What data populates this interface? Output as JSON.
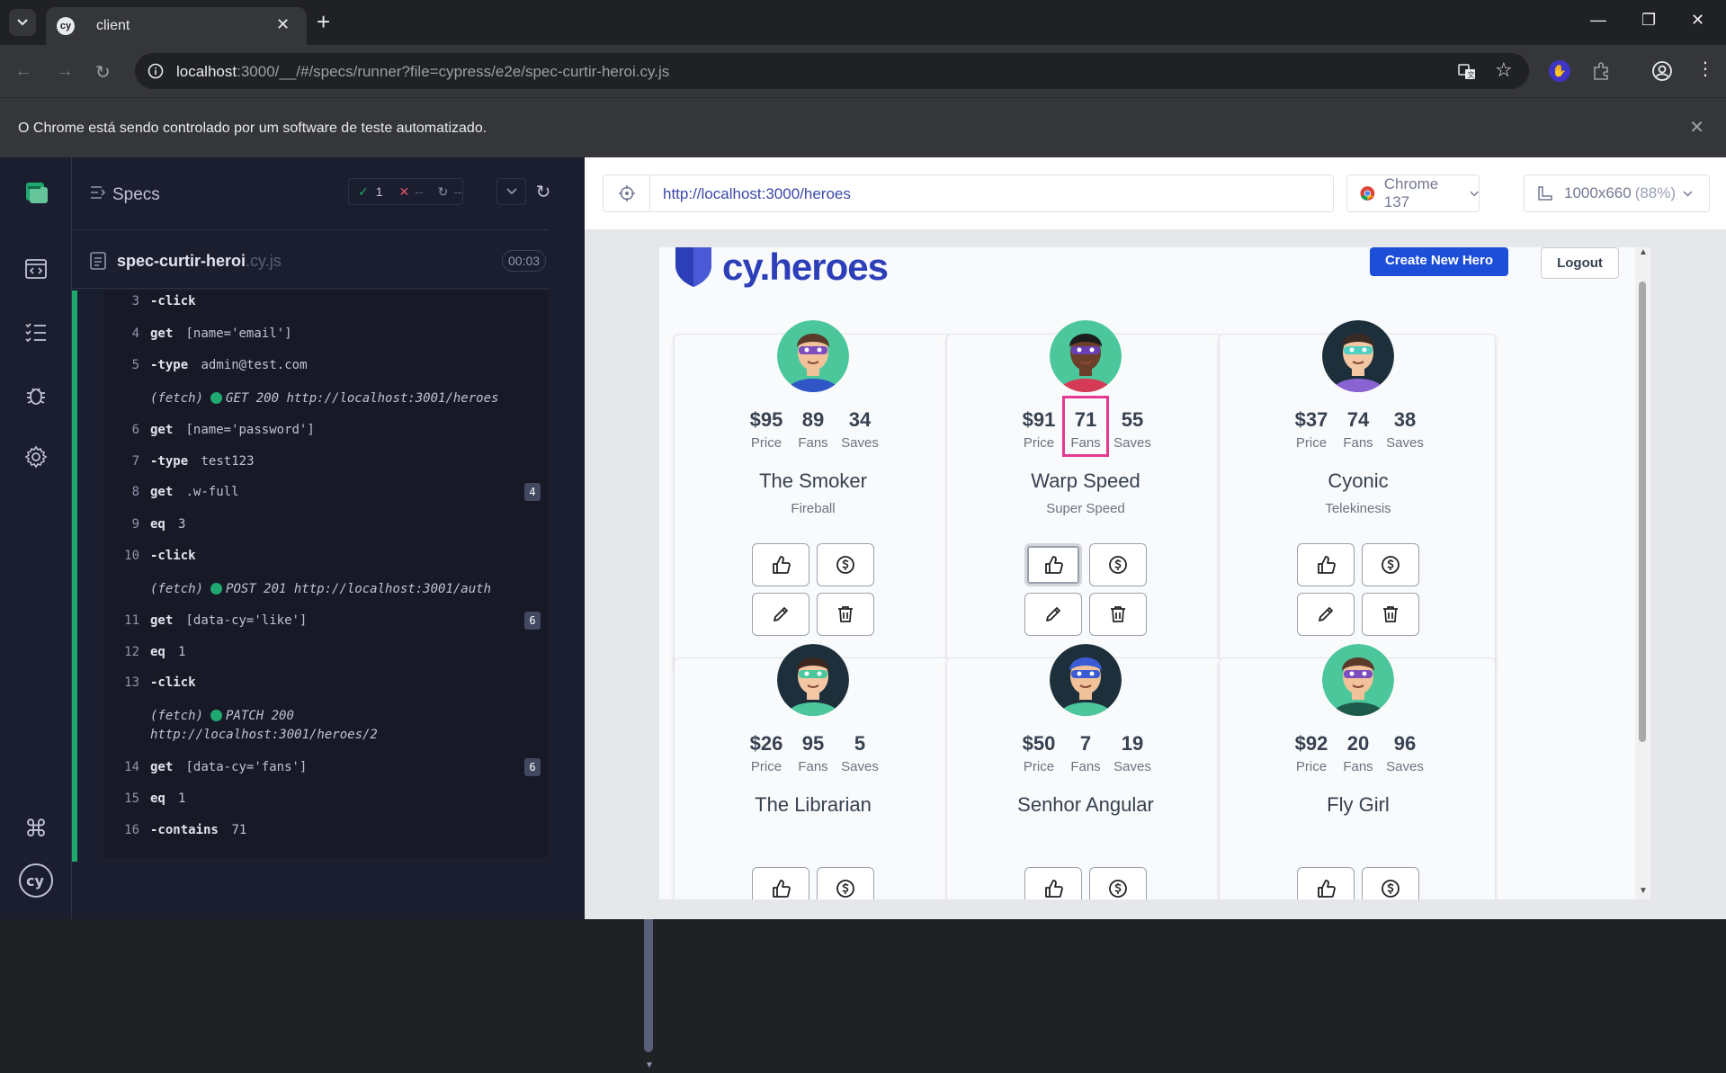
{
  "browser": {
    "tab_title": "client",
    "url_host": "localhost",
    "url_rest": ":3000/__/#/specs/runner?file=cypress/e2e/spec-curtir-heroi.cy.js",
    "infobar": "O Chrome está sendo controlado por um software de teste automatizado."
  },
  "reporter": {
    "specs_label": "Specs",
    "passed": "1",
    "failed": "--",
    "pending": "--",
    "file_name": "spec-curtir-heroi",
    "file_ext": ".cy.js",
    "duration": "00:03",
    "commands": [
      {
        "num": "3",
        "name": "-click",
        "arg": ""
      },
      {
        "num": "4",
        "name": "get",
        "arg": "[name='email']"
      },
      {
        "num": "5",
        "name": "-type",
        "arg": "admin@test.com"
      },
      {
        "fetch": "GET 200 http://localhost:3001/heroes"
      },
      {
        "num": "6",
        "name": "get",
        "arg": "[name='password']"
      },
      {
        "num": "7",
        "name": "-type",
        "arg": "test123"
      },
      {
        "num": "8",
        "name": "get",
        "arg": ".w-full",
        "badge": "4"
      },
      {
        "num": "9",
        "name": "eq",
        "arg": "3"
      },
      {
        "num": "10",
        "name": "-click",
        "arg": ""
      },
      {
        "fetch": "POST 201 http://localhost:3001/auth"
      },
      {
        "num": "11",
        "name": "get",
        "arg": "[data-cy='like']",
        "badge": "6"
      },
      {
        "num": "12",
        "name": "eq",
        "arg": "1"
      },
      {
        "num": "13",
        "name": "-click",
        "arg": ""
      },
      {
        "fetch": "PATCH 200",
        "fetch2": "http://localhost:3001/heroes/2"
      },
      {
        "num": "14",
        "name": "get",
        "arg": "[data-cy='fans']",
        "badge": "6"
      },
      {
        "num": "15",
        "name": "eq",
        "arg": "1"
      },
      {
        "num": "16",
        "name": "-contains",
        "arg": "71"
      }
    ],
    "fetch_prefix": "(fetch)"
  },
  "aut": {
    "url": "http://localhost:3000/heroes",
    "browser_label": "Chrome 137",
    "viewport": "1000x660",
    "zoom": "(88%)"
  },
  "app": {
    "logo": "cy.heroes",
    "create_button": "Create New Hero",
    "logout_button": "Logout",
    "labels": {
      "price": "Price",
      "fans": "Fans",
      "saves": "Saves"
    },
    "heroes": [
      {
        "price": "$95",
        "fans": "89",
        "saves": "34",
        "name": "The Smoker",
        "power": "Fireball",
        "skin": "#f1c29a",
        "hair": "#5b3a29",
        "mask": "#7c4dbd",
        "bg": "#4cc79c",
        "suit": "#2f55c7"
      },
      {
        "price": "$91",
        "fans": "71",
        "saves": "55",
        "name": "Warp Speed",
        "power": "Super Speed",
        "skin": "#6b3f2a",
        "hair": "#1d1d1d",
        "mask": "#6a3fb5",
        "bg": "#4cc79c",
        "suit": "#d63b55"
      },
      {
        "price": "$37",
        "fans": "74",
        "saves": "38",
        "name": "Cyonic",
        "power": "Telekinesis",
        "skin": "#f3c7a4",
        "hair": "#3a2a25",
        "mask": "#4fd0c0",
        "bg": "#1e2f3c",
        "suit": "#8a63d2"
      },
      {
        "price": "$26",
        "fans": "95",
        "saves": "5",
        "name": "The Librarian",
        "power": "",
        "skin": "#f3c7a4",
        "hair": "#3b2620",
        "mask": "#4cc79c",
        "bg": "#1e2f3c",
        "suit": "#4cc79c"
      },
      {
        "price": "$50",
        "fans": "7",
        "saves": "19",
        "name": "Senhor Angular",
        "power": "",
        "skin": "#f1c29a",
        "hair": "#3a5bd3",
        "mask": "#3a5bd3",
        "bg": "#1e2f3c",
        "suit": "#4cc79c"
      },
      {
        "price": "$92",
        "fans": "20",
        "saves": "96",
        "name": "Fly Girl",
        "power": "",
        "skin": "#f1c29a",
        "hair": "#5b3a29",
        "mask": "#7c4dbd",
        "bg": "#4cc79c",
        "suit": "#1e5a4c"
      }
    ]
  }
}
